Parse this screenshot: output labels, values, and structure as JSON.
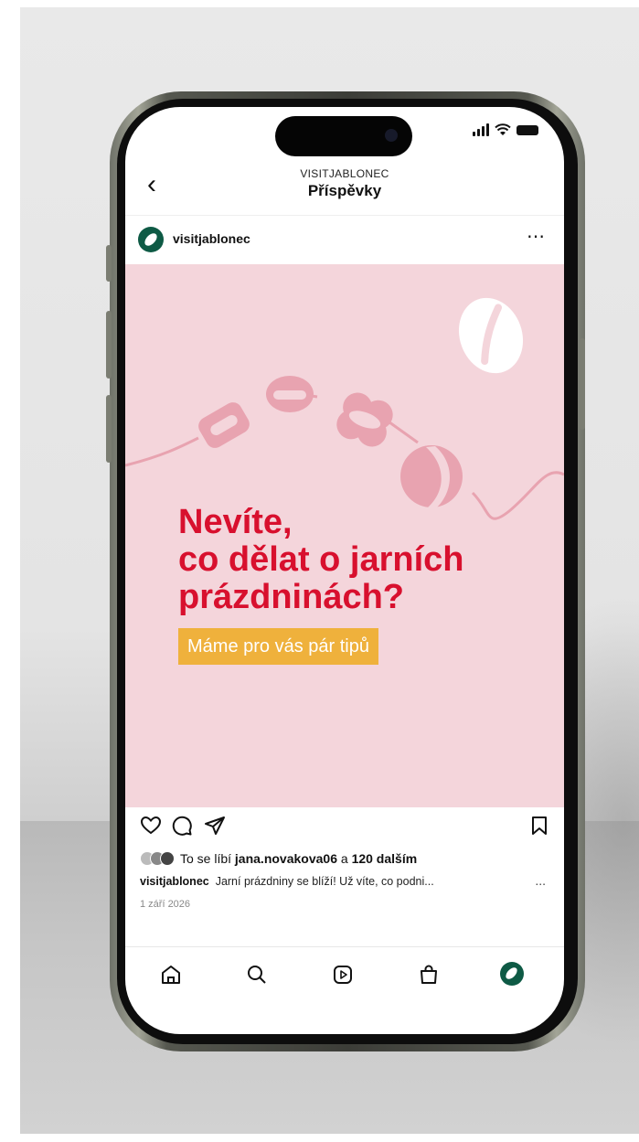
{
  "header": {
    "account": "VISITJABLONEC",
    "title": "Příspěvky"
  },
  "post": {
    "username": "visitjablonec",
    "image": {
      "headline_lines": [
        "Nevíte,",
        "co dělat o jarních",
        "prázdninách?"
      ],
      "tag": "Máme pro vás pár tipů",
      "colors": {
        "background": "#f4d5db",
        "headline": "#d8102e",
        "tag": "#efb13c",
        "accent": "#e8a3b0"
      }
    },
    "likes": {
      "prefix": "To se líbí",
      "user": "jana.novakova06",
      "connector": "a",
      "others": "120 dalším"
    },
    "caption": {
      "username": "visitjablonec",
      "text": "Jarní prázdniny se blíží! Už víte, co podni..."
    },
    "more_label": "...",
    "date": "1 září 2026"
  },
  "icons": {
    "back": "chevron-left-icon",
    "more": "more-icon",
    "actions": [
      "heart-icon",
      "comment-icon",
      "share-icon",
      "bookmark-icon"
    ],
    "nav": [
      "home-icon",
      "search-icon",
      "reels-icon",
      "shop-icon",
      "profile-avatar"
    ]
  },
  "brand_color": "#0e5a45"
}
